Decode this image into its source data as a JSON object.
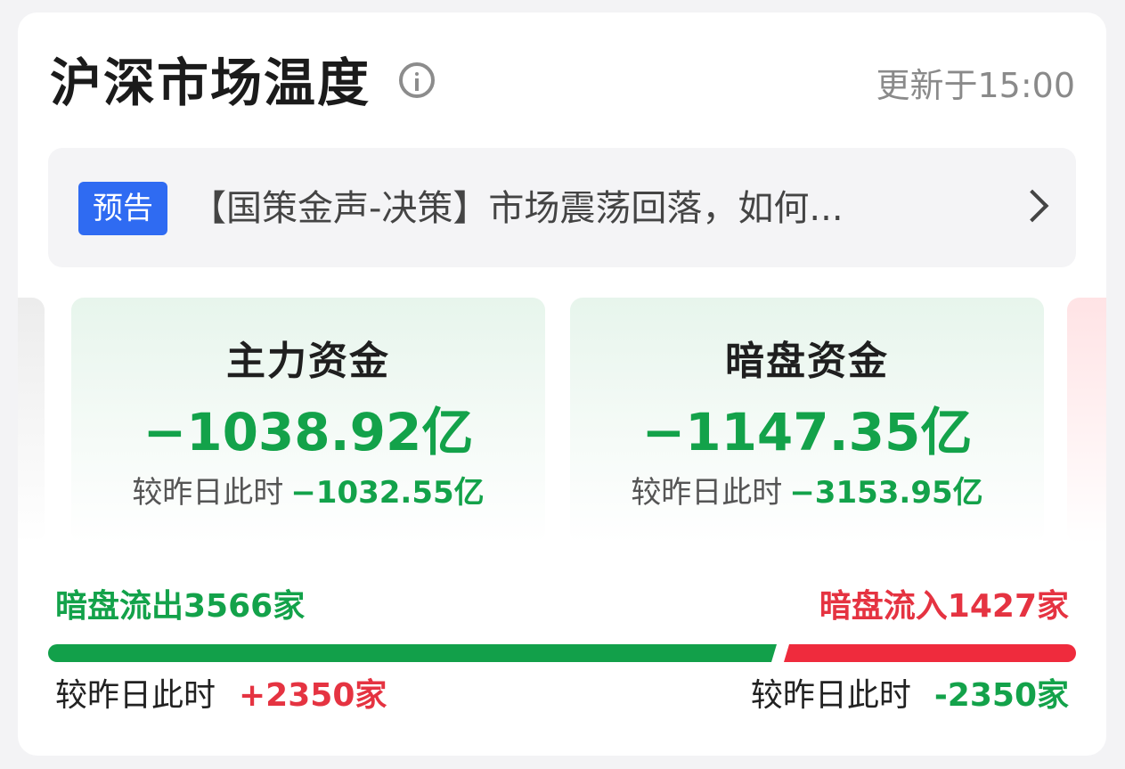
{
  "header": {
    "title": "沪深市场温度",
    "info_icon": "info-icon",
    "update_time": "更新于15:00"
  },
  "notice": {
    "badge": "预告",
    "text": "【国策金声-决策】市场震荡回落，如何...",
    "chevron_icon": "chevron-right-icon"
  },
  "funds": [
    {
      "title": "主力资金",
      "value": "−1038.92亿",
      "compare_label": "较昨日此时",
      "compare_value": "−1032.55亿"
    },
    {
      "title": "暗盘资金",
      "value": "−1147.35亿",
      "compare_label": "较昨日此时",
      "compare_value": "−3153.95亿"
    }
  ],
  "flow": {
    "out_label": "暗盘流出3566家",
    "in_label": "暗盘流入1427家",
    "out_count": 3566,
    "in_count": 1427,
    "out_compare_label": "较昨日此时",
    "out_compare_value": "+2350家",
    "in_compare_label": "较昨日此时",
    "in_compare_value": "-2350家"
  },
  "colors": {
    "green": "#13a24a",
    "red": "#e53341",
    "badge_blue": "#2f6bf2"
  }
}
